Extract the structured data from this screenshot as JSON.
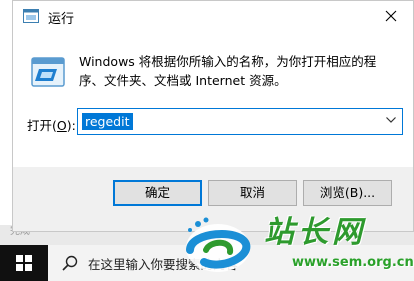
{
  "dialog": {
    "title": "运行",
    "description": "Windows 将根据你所输入的名称，为你打开相应的程序、文件夹、文档或 Internet 资源。",
    "open_label_prefix": "打开(",
    "open_label_accel": "O",
    "open_label_suffix": "):",
    "open_value": "regedit",
    "buttons": {
      "ok": "确定",
      "cancel": "取消",
      "browse": "浏览(B)..."
    }
  },
  "behind_window_text": "完成",
  "taskbar": {
    "search_placeholder": "在这里输入你要搜索的内容"
  },
  "watermark": {
    "chars": "站长网",
    "url": "www.sem.org.cn"
  },
  "colors": {
    "accent": "#0078d7",
    "taskbar": "#101010",
    "watermark": "#2e9a2e"
  }
}
